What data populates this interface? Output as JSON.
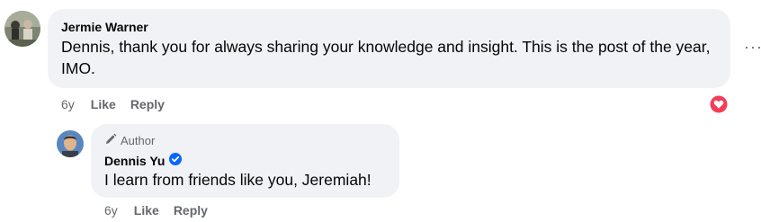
{
  "comment": {
    "author": "Jermie Warner",
    "text": "Dennis, thank you for always sharing your knowledge and insight. This is the post of the year, IMO.",
    "time": "6y",
    "like_label": "Like",
    "reply_label": "Reply",
    "more_label": "···",
    "reaction_icon": "heart-reaction-icon",
    "reaction_color": "#f33e58"
  },
  "reply": {
    "badge": "Author",
    "badge_icon": "pencil-icon",
    "author": "Dennis Yu",
    "verified_icon": "verified-badge-icon",
    "verified_color": "#0866ff",
    "text": "I learn from friends like you, Jeremiah!",
    "time": "6y",
    "like_label": "Like",
    "reply_label": "Reply"
  },
  "colors": {
    "bubble": "#f0f2f5",
    "meta": "#65676b",
    "text": "#050505"
  }
}
